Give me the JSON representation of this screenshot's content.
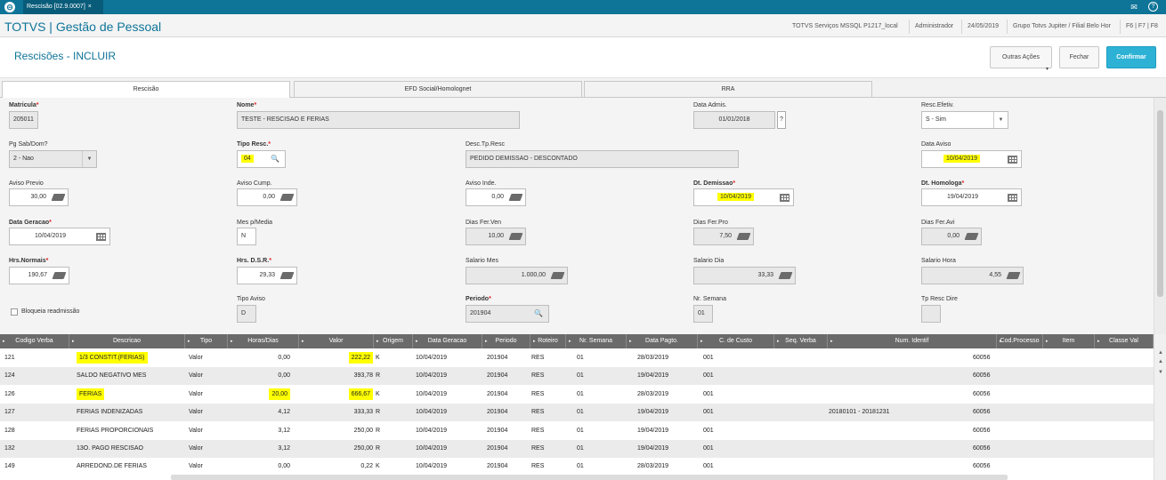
{
  "topbar": {
    "logo_glyph": "⊝",
    "tab_label": "Rescisão [02.9.0007]",
    "tab_close": "×",
    "mail_icon": "✉",
    "help_icon": "?"
  },
  "brandbar": {
    "brand": "TOTVS | Gestão de Pessoal",
    "server": "TOTVS Serviços MSSQL P1217_local",
    "user": "Administrador",
    "date": "24/05/2019",
    "company": "Grupo Totvs Jupiter / Filial Belo Hor",
    "shortcuts": "F6 | F7 | F8"
  },
  "page": {
    "title": "Rescisões - INCLUIR",
    "btn_actions": "Outras Ações",
    "btn_close": "Fechar",
    "btn_confirm": "Confirmar",
    "caret": "▾"
  },
  "tabs": [
    "Rescisão",
    "EFD Social/Homolognet",
    "RRA"
  ],
  "form": {
    "matricula": {
      "label": "Matricula",
      "value": "205011"
    },
    "nome": {
      "label": "Nome",
      "value": "TESTE - RESCISAO E FERIAS"
    },
    "data_admis": {
      "label": "Data Admis.",
      "value": "01/01/2018",
      "help": "?"
    },
    "resc_efetiv": {
      "label": "Resc.Efetiv.",
      "value": "S - Sim",
      "arrow": "▼"
    },
    "pg_sab_dom": {
      "label": "Pg Sab/Dom?",
      "value": "2 - Nao",
      "arrow": "▼"
    },
    "tipo_resc": {
      "label": "Tipo Resc.",
      "value": "04"
    },
    "desc_tp_resc": {
      "label": "Desc.Tp.Resc",
      "value": "PEDIDO DEMISSAO - DESCONTADO"
    },
    "data_aviso": {
      "label": "Data Aviso",
      "value": "10/04/2019"
    },
    "aviso_previo": {
      "label": "Aviso Previo",
      "value": "30,00"
    },
    "aviso_cump": {
      "label": "Aviso Cump.",
      "value": "0,00"
    },
    "aviso_inde": {
      "label": "Aviso Inde.",
      "value": "0,00"
    },
    "dt_demissao": {
      "label": "Dt. Demissao",
      "value": "10/04/2019"
    },
    "dt_homologa": {
      "label": "Dt. Homologa",
      "value": "19/04/2019"
    },
    "data_geracao": {
      "label": "Data Geracao",
      "value": "10/04/2019"
    },
    "mes_p_media": {
      "label": "Mes p/Media",
      "value": "N"
    },
    "dias_fer_ven": {
      "label": "Dias Fer.Ven",
      "value": "10,00"
    },
    "dias_fer_pro": {
      "label": "Dias Fer.Pro",
      "value": "7,50"
    },
    "dias_fer_avi": {
      "label": "Dias Fer.Avi",
      "value": "0,00"
    },
    "hrs_normais": {
      "label": "Hrs.Normais",
      "value": "190,67"
    },
    "hrs_dsr": {
      "label": "Hrs. D.S.R.",
      "value": "29,33"
    },
    "salario_mes": {
      "label": "Salario Mes",
      "value": "1.000,00"
    },
    "salario_dia": {
      "label": "Salario Dia",
      "value": "33,33"
    },
    "salario_hora": {
      "label": "Salario Hora",
      "value": "4,55"
    },
    "bloqueia": {
      "label": "Bloqueia readmissão"
    },
    "tipo_aviso": {
      "label": "Tipo Aviso",
      "value": "D"
    },
    "periodo": {
      "label": "Periodo",
      "value": "201904"
    },
    "nr_semana": {
      "label": "Nr. Semana",
      "value": "01"
    },
    "tp_resc_dire": {
      "label": "Tp Resc Dire",
      "value": ""
    },
    "search_glyph": "🔍"
  },
  "grid": {
    "columns": [
      "Codigo Verba",
      "Descricao",
      "Tipo",
      "Horas/Dias",
      "Valor",
      "Origem",
      "Data Geracao",
      "Periodo",
      "Roteiro",
      "Nr. Semana",
      "Data Pagto.",
      "C. de Custo",
      "Seq. Verba",
      "Num. Identif",
      "Cod.Processo",
      "Item",
      "Classe Val"
    ],
    "rows": [
      {
        "codigo": "121",
        "descricao": "1/3 CONSTIT.(FERIAS)",
        "tipo": "Valor",
        "horas": "0,00",
        "valor": "222,22",
        "origem": "K",
        "data_geracao": "10/04/2019",
        "periodo": "201904",
        "roteiro": "RES",
        "nr_semana": "01",
        "data_pagto": "28/03/2019",
        "c_custo": "001",
        "seq_verba": "",
        "num_identif": "",
        "cod_processo": "60056",
        "item": "",
        "classe_val": ""
      },
      {
        "codigo": "124",
        "descricao": "SALDO NEGATIVO MES",
        "tipo": "Valor",
        "horas": "0,00",
        "valor": "393,78",
        "origem": "R",
        "data_geracao": "10/04/2019",
        "periodo": "201904",
        "roteiro": "RES",
        "nr_semana": "01",
        "data_pagto": "19/04/2019",
        "c_custo": "001",
        "seq_verba": "",
        "num_identif": "",
        "cod_processo": "60056",
        "item": "",
        "classe_val": ""
      },
      {
        "codigo": "126",
        "descricao": "FERIAS",
        "tipo": "Valor",
        "horas": "20,00",
        "valor": "666,67",
        "origem": "K",
        "data_geracao": "10/04/2019",
        "periodo": "201904",
        "roteiro": "RES",
        "nr_semana": "01",
        "data_pagto": "28/03/2019",
        "c_custo": "001",
        "seq_verba": "",
        "num_identif": "",
        "cod_processo": "60056",
        "item": "",
        "classe_val": ""
      },
      {
        "codigo": "127",
        "descricao": "FERIAS INDENIZADAS",
        "tipo": "Valor",
        "horas": "4,12",
        "valor": "333,33",
        "origem": "R",
        "data_geracao": "10/04/2019",
        "periodo": "201904",
        "roteiro": "RES",
        "nr_semana": "01",
        "data_pagto": "19/04/2019",
        "c_custo": "001",
        "seq_verba": "",
        "num_identif": "20180101 - 20181231",
        "cod_processo": "60056",
        "item": "",
        "classe_val": ""
      },
      {
        "codigo": "128",
        "descricao": "FERIAS PROPORCIONAIS",
        "tipo": "Valor",
        "horas": "3,12",
        "valor": "250,00",
        "origem": "R",
        "data_geracao": "10/04/2019",
        "periodo": "201904",
        "roteiro": "RES",
        "nr_semana": "01",
        "data_pagto": "19/04/2019",
        "c_custo": "001",
        "seq_verba": "",
        "num_identif": "",
        "cod_processo": "60056",
        "item": "",
        "classe_val": ""
      },
      {
        "codigo": "132",
        "descricao": "13O. PAGO RESCISAO",
        "tipo": "Valor",
        "horas": "3,12",
        "valor": "250,00",
        "origem": "R",
        "data_geracao": "10/04/2019",
        "periodo": "201904",
        "roteiro": "RES",
        "nr_semana": "01",
        "data_pagto": "19/04/2019",
        "c_custo": "001",
        "seq_verba": "",
        "num_identif": "",
        "cod_processo": "60056",
        "item": "",
        "classe_val": ""
      },
      {
        "codigo": "149",
        "descricao": "ARREDOND.DE FERIAS",
        "tipo": "Valor",
        "horas": "0,00",
        "valor": "0,22",
        "origem": "K",
        "data_geracao": "10/04/2019",
        "periodo": "201904",
        "roteiro": "RES",
        "nr_semana": "01",
        "data_pagto": "28/03/2019",
        "c_custo": "001",
        "seq_verba": "",
        "num_identif": "",
        "cod_processo": "60056",
        "item": "",
        "classe_val": ""
      }
    ],
    "scroll_up": "▲",
    "scroll_down": "▼"
  },
  "colors": {
    "brand": "#0e7498",
    "primary": "#2db2d6",
    "highlight": "#ffff00",
    "grid_header": "#6a6a6a"
  }
}
